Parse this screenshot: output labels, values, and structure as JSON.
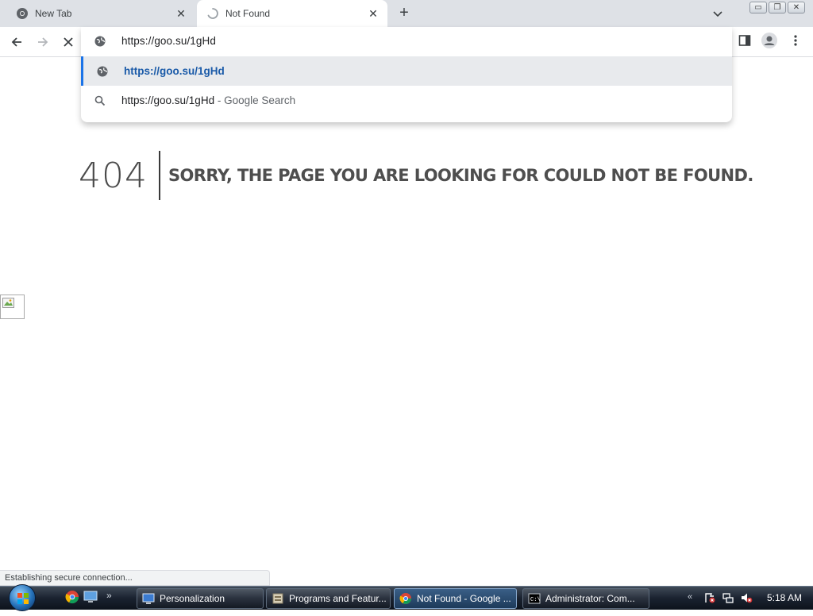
{
  "browser": {
    "tabs": [
      {
        "title": "New Tab",
        "icon": "chrome-icon"
      },
      {
        "title": "Not Found",
        "icon": "loading-spinner-icon"
      }
    ],
    "new_tab_symbol": "+",
    "close_symbol": "✕",
    "window_controls": {
      "minimize": "▭",
      "restore": "❐",
      "close": "✕"
    },
    "omnibox": {
      "value": "https://goo.su/1gHd",
      "suggestions": [
        {
          "text": "https://goo.su/1gHd",
          "description": "",
          "icon": "globe-icon"
        },
        {
          "text": "https://goo.su/1gHd",
          "description": " - Google Search",
          "icon": "search-icon"
        }
      ]
    },
    "status_text": "Establishing secure connection..."
  },
  "page": {
    "error_code": "404",
    "error_message": "SORRY, THE PAGE YOU ARE LOOKING FOR COULD NOT BE FOUND."
  },
  "taskbar": {
    "buttons": [
      {
        "label": "Personalization",
        "icon": "personalization-icon"
      },
      {
        "label": "Programs and Featur...",
        "icon": "programs-icon"
      },
      {
        "label": "Not Found - Google ...",
        "icon": "chrome-icon"
      },
      {
        "label": "Administrator:  Com...",
        "icon": "cmd-icon"
      }
    ],
    "clock": "5:18 AM"
  },
  "colors": {
    "accent": "#1a73e8",
    "tab_strip": "#dee1e6",
    "taskbar": "#1a2230"
  }
}
